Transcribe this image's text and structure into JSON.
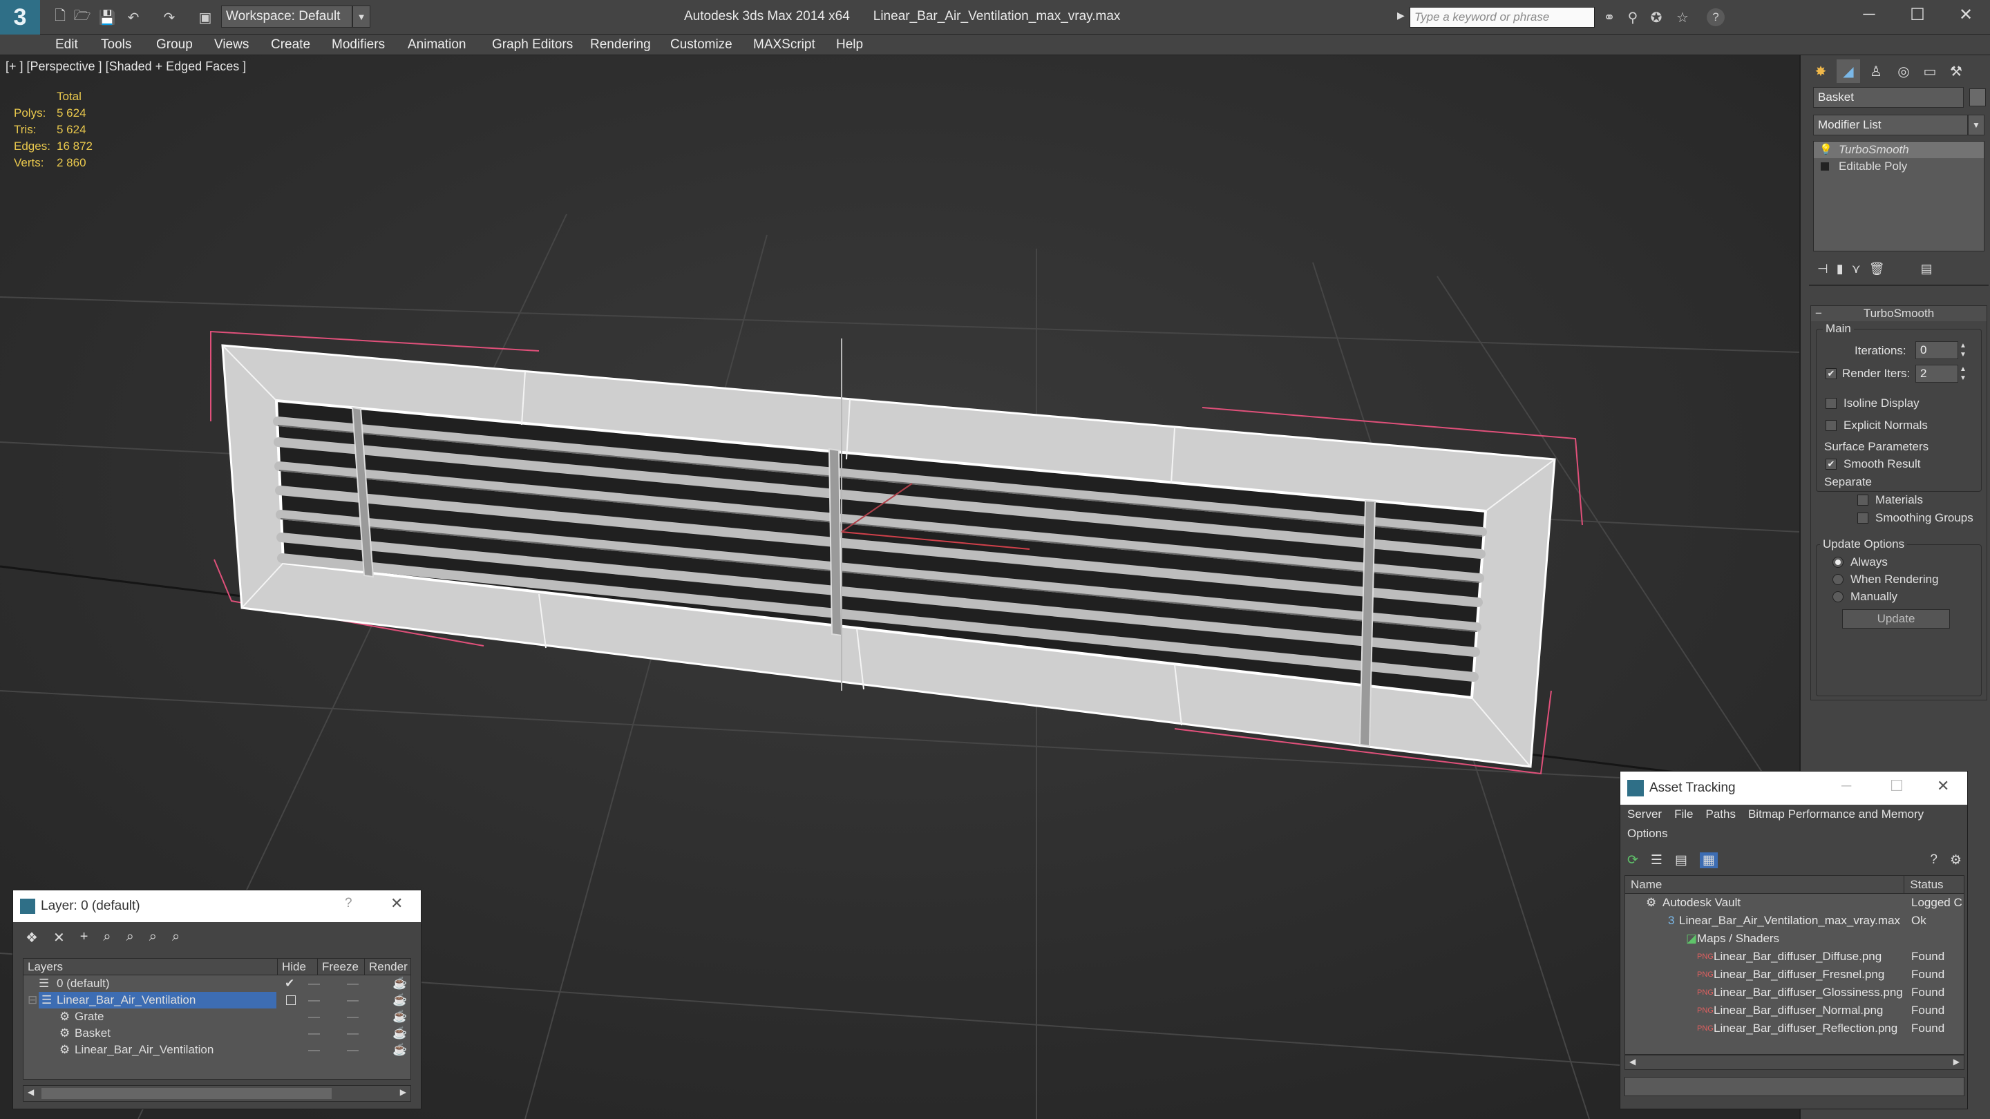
{
  "window": {
    "app_name": "Autodesk 3ds Max  2014 x64",
    "file_name": "Linear_Bar_Air_Ventilation_max_vray.max",
    "workspace": "Workspace: Default",
    "search_placeholder": "Type a keyword or phrase",
    "min_glyph": "─",
    "max_glyph": "☐",
    "close_glyph": "✕"
  },
  "menu": [
    "Edit",
    "Tools",
    "Group",
    "Views",
    "Create",
    "Modifiers",
    "Animation",
    "Graph Editors",
    "Rendering",
    "Customize",
    "MAXScript",
    "Help"
  ],
  "viewport": {
    "label": "[+ ] [Perspective ] [Shaded + Edged Faces ]",
    "stats": {
      "header": "Total",
      "rows": [
        {
          "label": "Polys:",
          "value": "5 624"
        },
        {
          "label": "Tris:",
          "value": "5 624"
        },
        {
          "label": "Edges:",
          "value": "16 872"
        },
        {
          "label": "Verts:",
          "value": "2 860"
        }
      ]
    }
  },
  "command_panel": {
    "object_name": "Basket",
    "modifier_list": "Modifier List",
    "stack": [
      "TurboSmooth",
      "Editable Poly"
    ],
    "rollout_title": "TurboSmooth",
    "main_group": "Main",
    "iterations_label": "Iterations:",
    "iterations_value": "0",
    "render_iters_label": "Render Iters:",
    "render_iters_value": "2",
    "isoline": "Isoline Display",
    "explicit_normals": "Explicit Normals",
    "surface_params": "Surface Parameters",
    "smooth_result": "Smooth Result",
    "separate": "Separate",
    "materials": "Materials",
    "smoothing_groups": "Smoothing Groups",
    "update_options": "Update Options",
    "always": "Always",
    "when_rendering": "When Rendering",
    "manually": "Manually",
    "update_button": "Update"
  },
  "layer_dialog": {
    "title": "Layer: 0 (default)",
    "help_glyph": "?",
    "headers": [
      "Layers",
      "Hide",
      "Freeze",
      "Render"
    ],
    "rows": [
      {
        "name": "0 (default)",
        "indent": 1
      },
      {
        "name": "Linear_Bar_Air_Ventilation",
        "indent": 1,
        "selected": true
      },
      {
        "name": "Grate",
        "indent": 2
      },
      {
        "name": "Basket",
        "indent": 2
      },
      {
        "name": "Linear_Bar_Air_Ventilation",
        "indent": 2
      }
    ]
  },
  "asset_tracking": {
    "title": "Asset Tracking",
    "menu": [
      "Server",
      "File",
      "Paths",
      "Bitmap Performance and Memory",
      "Options"
    ],
    "headers": [
      "Name",
      "Status"
    ],
    "rows": [
      {
        "name": "Autodesk Vault",
        "status": "Logged C"
      },
      {
        "name": "Linear_Bar_Air_Ventilation_max_vray.max",
        "status": "Ok"
      },
      {
        "name": "Maps / Shaders",
        "status": ""
      },
      {
        "name": "Linear_Bar_diffuser_Diffuse.png",
        "status": "Found"
      },
      {
        "name": "Linear_Bar_diffuser_Fresnel.png",
        "status": "Found"
      },
      {
        "name": "Linear_Bar_diffuser_Glossiness.png",
        "status": "Found"
      },
      {
        "name": "Linear_Bar_diffuser_Normal.png",
        "status": "Found"
      },
      {
        "name": "Linear_Bar_diffuser_Reflection.png",
        "status": "Found"
      }
    ]
  },
  "colors": {
    "stats_yellow": "#e9c84d",
    "selection_blue": "#3d6db3",
    "accent_teal": "#2f6f87",
    "bbox_pink": "#e0507a"
  }
}
